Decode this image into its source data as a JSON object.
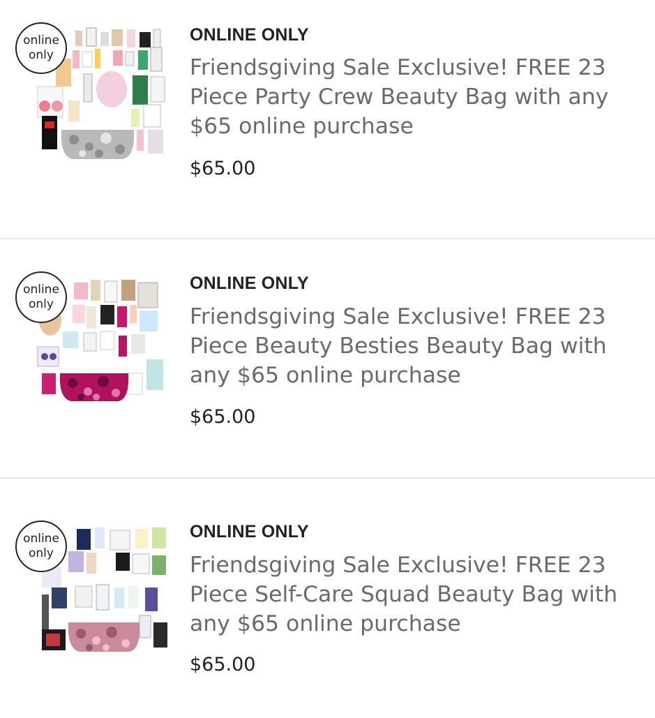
{
  "products": [
    {
      "badge": "online\nonly",
      "tag": "ONLINE ONLY",
      "title": "Friendsgiving Sale Exclusive! FREE 23 Piece Party Crew Beauty Bag with any $65 online purchase",
      "price": "$65.00",
      "bag_color": "#b9b9b9",
      "bag_accent": "#8e8e8e"
    },
    {
      "badge": "online\nonly",
      "tag": "ONLINE ONLY",
      "title": "Friendsgiving Sale Exclusive! FREE 23 Piece Beauty Besties Beauty Bag with any $65 online purchase",
      "price": "$65.00",
      "bag_color": "#b0125e",
      "bag_accent": "#6e0a3c"
    },
    {
      "badge": "online\nonly",
      "tag": "ONLINE ONLY",
      "title": "Friendsgiving Sale Exclusive! FREE 23 Piece Self-Care Squad Beauty Bag with any $65 online purchase",
      "price": "$65.00",
      "bag_color": "#c98a9b",
      "bag_accent": "#9c5b6c"
    }
  ],
  "colors": {
    "divider": "#e6e6e6",
    "title_text": "#6a6a6a",
    "primary_text": "#222222"
  }
}
